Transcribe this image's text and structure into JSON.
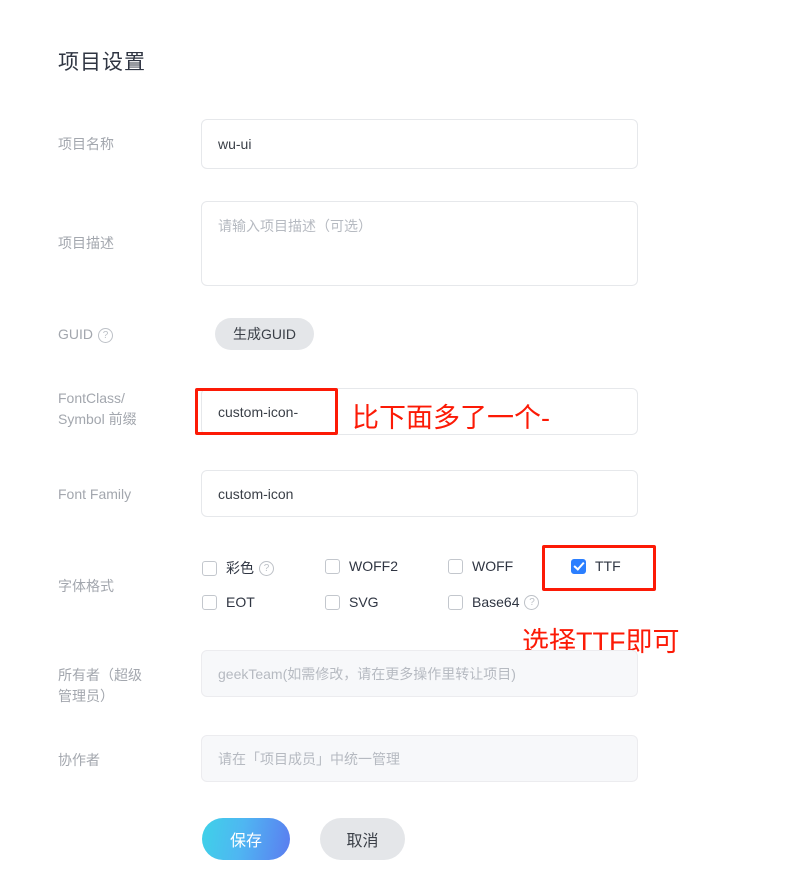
{
  "page": {
    "title": "项目设置"
  },
  "fields": {
    "project_name": {
      "label": "项目名称",
      "value": "wu-ui"
    },
    "project_desc": {
      "label": "项目描述",
      "placeholder": "请输入项目描述（可选）"
    },
    "guid": {
      "label": "GUID",
      "help_icon": "question-mark-icon",
      "button": "生成GUID"
    },
    "fontclass_prefix": {
      "label_line1": "FontClass/",
      "label_line2": "Symbol 前缀",
      "value": "custom-icon-"
    },
    "font_family": {
      "label": "Font Family",
      "value": "custom-icon"
    },
    "font_format": {
      "label": "字体格式",
      "options": [
        {
          "label": "彩色",
          "checked": false,
          "help": true
        },
        {
          "label": "WOFF2",
          "checked": false,
          "help": false
        },
        {
          "label": "WOFF",
          "checked": false,
          "help": false
        },
        {
          "label": "TTF",
          "checked": true,
          "help": false
        },
        {
          "label": "EOT",
          "checked": false,
          "help": false
        },
        {
          "label": "SVG",
          "checked": false,
          "help": false
        },
        {
          "label": "Base64",
          "checked": false,
          "help": true
        }
      ]
    },
    "owner": {
      "label_line1": "所有者（超级",
      "label_line2": "管理员）",
      "placeholder": "geekTeam(如需修改，请在更多操作里转让项目)"
    },
    "collaborator": {
      "label": "协作者",
      "placeholder": "请在「项目成员」中统一管理"
    }
  },
  "footer": {
    "save": "保存",
    "cancel": "取消"
  },
  "annotations": {
    "prefix_note": "比下面多了一个-",
    "ttf_note": "选择TTF即可",
    "color": "#fc1a06"
  }
}
